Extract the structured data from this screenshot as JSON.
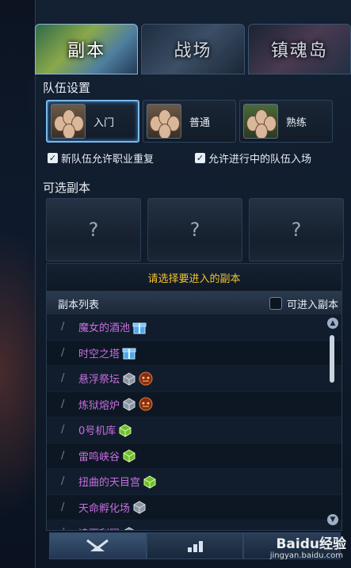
{
  "tabs": [
    {
      "label": "副本"
    },
    {
      "label": "战场"
    },
    {
      "label": "镇魂岛"
    }
  ],
  "team_settings": {
    "title": "队伍设置",
    "difficulties": [
      {
        "label": "入门"
      },
      {
        "label": "普通"
      },
      {
        "label": "熟练"
      }
    ],
    "allow_duplicate_class": "新队伍允许职业重复",
    "allow_in_progress": "允许进行中的队伍入场"
  },
  "optional": {
    "title": "可选副本",
    "slots": [
      "?",
      "?",
      "?"
    ],
    "hint": "请选择要进入的副本"
  },
  "dungeon_list": {
    "header": "副本列表",
    "enterable_label": "可进入副本",
    "rows": [
      {
        "name": "魔女的酒池",
        "icons": [
          "gift-icon"
        ]
      },
      {
        "name": "时空之塔",
        "icons": [
          "gift-icon"
        ]
      },
      {
        "name": "悬浮祭坛",
        "icons": [
          "gray-chest-icon",
          "demon-face-icon"
        ]
      },
      {
        "name": "炼狱熔炉",
        "icons": [
          "gray-chest-icon",
          "demon-face-icon"
        ]
      },
      {
        "name": "0号机库",
        "icons": [
          "green-chest-icon"
        ]
      },
      {
        "name": "雷鸣峡谷",
        "icons": [
          "green-chest-icon"
        ]
      },
      {
        "name": "扭曲的天目宫",
        "icons": [
          "green-chest-icon"
        ]
      },
      {
        "name": "天命孵化场",
        "icons": [
          "gray-chest-icon"
        ]
      },
      {
        "name": "追而利园",
        "icons": [
          "gray-chest-icon"
        ]
      }
    ]
  },
  "watermark": {
    "brand": "Baidu经验",
    "url": "jingyan.baidu.com"
  },
  "colors": {
    "dungeon_name": "#c86ee0",
    "hint": "#f1c232",
    "active_border": "#7ab8ea"
  }
}
